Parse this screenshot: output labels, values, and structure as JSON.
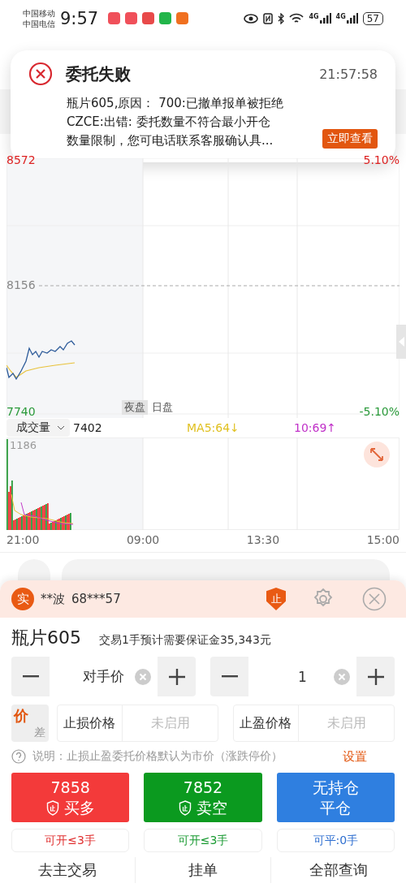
{
  "status_bar": {
    "carriers": [
      "中国移动",
      "中国电信"
    ],
    "time": "9:57",
    "network": [
      "4G",
      "4G"
    ],
    "battery": "57"
  },
  "notification": {
    "title": "委托失败",
    "time": "21:57:58",
    "lines": [
      "瓶片605,原因：  700:已撤单报单被拒绝",
      "CZCE:出错: 委托数量不符合最小开仓",
      "数量限制，您可电话联系客服确认具..."
    ],
    "button": "立即查看"
  },
  "price_chart": {
    "high": "8572",
    "mid": "8156",
    "low": "7740",
    "high_pct": "5.10%",
    "low_pct": "-5.10%",
    "sessions": [
      {
        "label": "夜盘",
        "selected": true
      },
      {
        "label": "日盘",
        "selected": false
      }
    ]
  },
  "volume": {
    "selector": "成交量",
    "value": "7402",
    "ma5": "MA5:64↓",
    "ma10": "10:69↑",
    "max": "1186"
  },
  "time_axis": [
    "21:00",
    "09:00",
    "13:30",
    "15:00"
  ],
  "account": {
    "badge": "实",
    "name": "**波",
    "id": "68***57",
    "stop_badge": "止"
  },
  "contract": {
    "name": "瓶片605",
    "margin_note": "交易1手预计需要保证金35,343元"
  },
  "price_field": {
    "value": "对手价"
  },
  "quantity_field": {
    "value": "1"
  },
  "mode_toggle": {
    "main": "价",
    "alt": "差"
  },
  "stop_fields": [
    {
      "label": "止损价格",
      "placeholder": "未启用"
    },
    {
      "label": "止盈价格",
      "placeholder": "未启用"
    }
  ],
  "note": {
    "text": "说明：止损止盈委托价格默认为市价（涨跌停价）",
    "link": "设置"
  },
  "actions": [
    {
      "kind": "buy",
      "line1": "7858",
      "line2": "买多",
      "available": "可开≤3手"
    },
    {
      "kind": "sell",
      "line1": "7852",
      "line2": "卖空",
      "available": "可开≤3手"
    },
    {
      "kind": "close",
      "line1": "无持仓",
      "line2": "平仓",
      "available": "可平:0手"
    }
  ],
  "bottom_tabs": [
    "去主交易",
    "挂单",
    "全部查询"
  ]
}
